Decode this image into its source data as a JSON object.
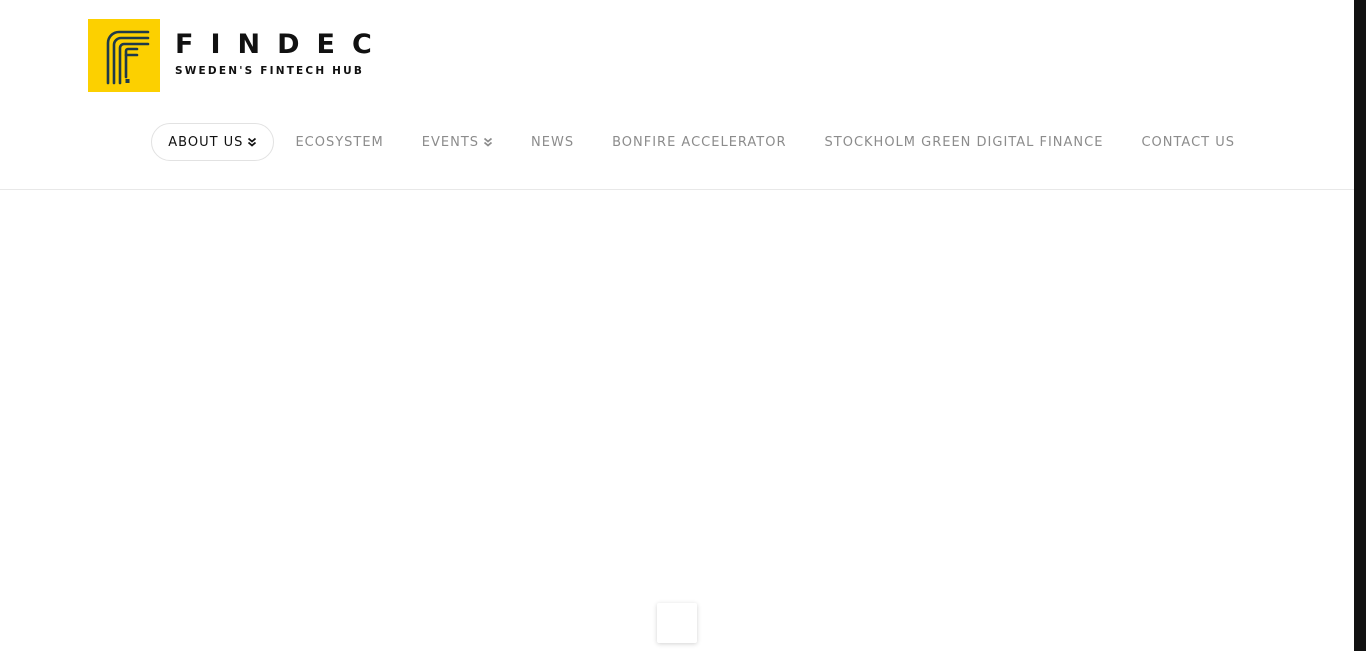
{
  "brand": {
    "name": "FINDEC",
    "tagline": "SWEDEN'S FINTECH HUB",
    "logo_icon": "findec-f-logo-icon",
    "accent_color": "#fcd000",
    "logo_line_color": "#1e3a4a"
  },
  "nav": {
    "items": [
      {
        "label": "ABOUT US",
        "has_dropdown": true,
        "active": true
      },
      {
        "label": "ECOSYSTEM",
        "has_dropdown": false,
        "active": false
      },
      {
        "label": "EVENTS",
        "has_dropdown": true,
        "active": false
      },
      {
        "label": "NEWS",
        "has_dropdown": false,
        "active": false
      },
      {
        "label": "BONFIRE ACCELERATOR",
        "has_dropdown": false,
        "active": false
      },
      {
        "label": "STOCKHOLM GREEN DIGITAL FINANCE",
        "has_dropdown": false,
        "active": false
      },
      {
        "label": "CONTACT US",
        "has_dropdown": false,
        "active": false
      }
    ],
    "dropdown_icon": "double-chevron-down-icon"
  },
  "colors": {
    "nav_text": "#8c8c8c",
    "nav_active_text": "#111111",
    "scrollbar": "#111111"
  }
}
